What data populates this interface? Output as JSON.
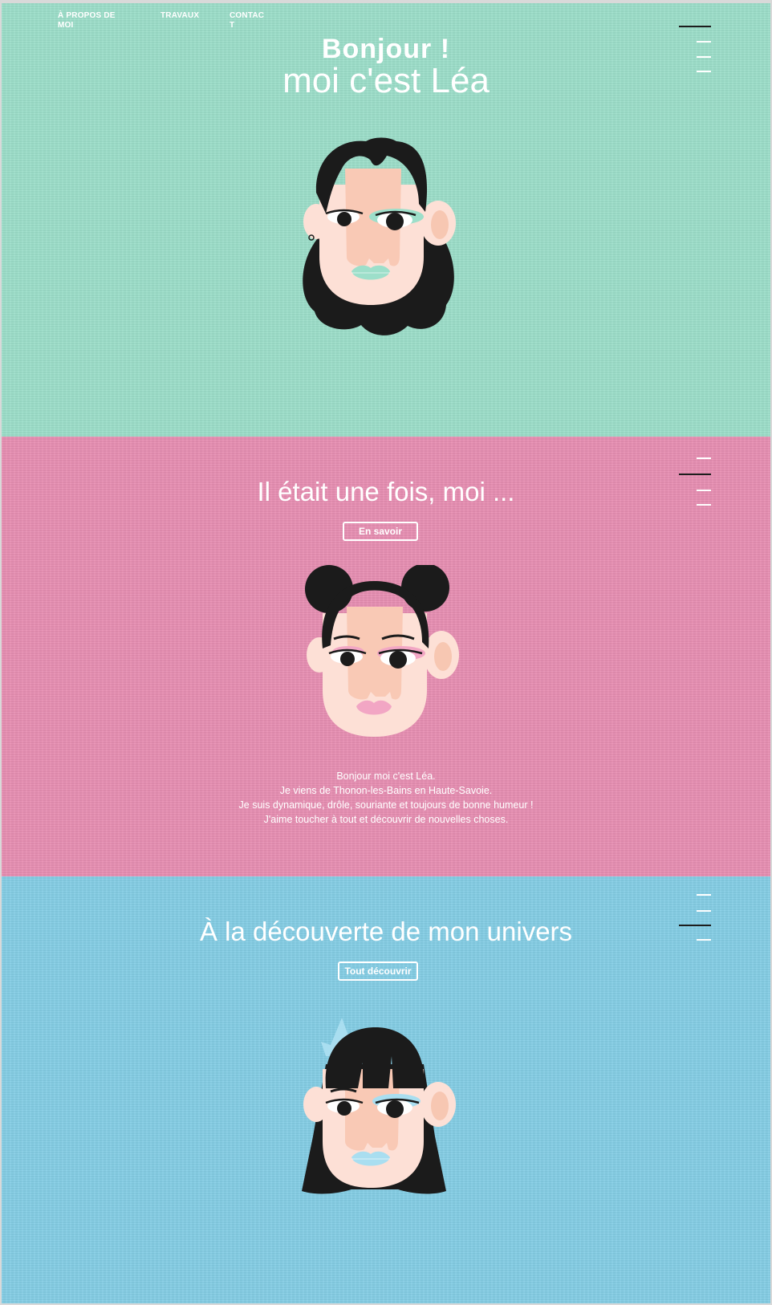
{
  "nav": {
    "items": [
      {
        "label": "À PROPOS DE MOI"
      },
      {
        "label": "TRAVAUX"
      },
      {
        "label": "CONTACT"
      }
    ]
  },
  "hero": {
    "title_bold": "Bonjour !",
    "title_light": "moi c'est Léa"
  },
  "about": {
    "heading": "Il était une fois, moi ...",
    "button_label": "En savoir",
    "bio_lines": [
      "Bonjour moi c'est Léa.",
      "Je viens de Thonon-les-Bains en Haute-Savoie.",
      "Je suis dynamique, drôle, souriante et toujours de bonne humeur !",
      "J'aime toucher à tout et découvrir de nouvelles choses."
    ]
  },
  "universe": {
    "heading": "À la découverte de mon univers",
    "button_label": "Tout découvrir"
  },
  "colors": {
    "mint": "#9ddfca",
    "pink": "#e88fb3",
    "sky": "#85cee6",
    "skin": "#fde0d6",
    "hair": "#1b1b1b"
  },
  "icons": [
    "menu-lines-icon",
    "avatar-curly-hair-illustration",
    "avatar-space-buns-illustration",
    "avatar-bangs-crown-illustration"
  ]
}
